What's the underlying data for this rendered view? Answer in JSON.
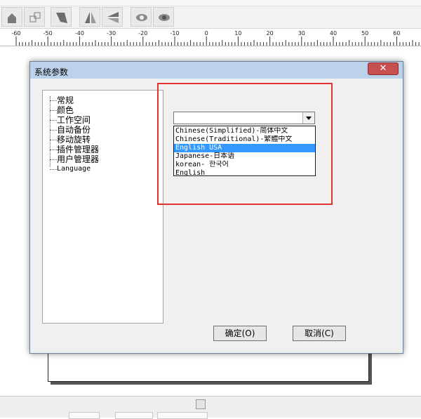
{
  "dialog": {
    "title": "系统参数",
    "close_label": "✕",
    "tree": {
      "items": [
        "常规",
        "颜色",
        "工作空间",
        "自动备份",
        "移动旋转",
        "插件管理器",
        "用户管理器",
        "Language"
      ]
    },
    "language": {
      "current_value": "",
      "options": [
        "Chinese(Simplified)-简体中文",
        "Chinese(Traditional)-繁體中文",
        "English USA",
        "Japanese-日本语",
        "korean- 한국어",
        "English"
      ],
      "selected_index": 2
    },
    "buttons": {
      "ok": "确定(O)",
      "cancel": "取消(C)"
    }
  },
  "ruler": {
    "ticks": [
      "-60",
      "-50",
      "-40",
      "-30",
      "-20",
      "-10",
      "0",
      "10",
      "20",
      "30",
      "40",
      "50",
      "60"
    ]
  },
  "toolbar": {
    "icons": [
      "lock-icon",
      "align-icon",
      "cut-icon",
      "flip-horizontal-icon",
      "flip-vertical-icon",
      "show-icon",
      "hide-icon"
    ]
  },
  "colors": {
    "highlight": "#3399ff",
    "annotation": "#e53030",
    "titlebar": "#bcd2eb",
    "close": "#c75050"
  }
}
